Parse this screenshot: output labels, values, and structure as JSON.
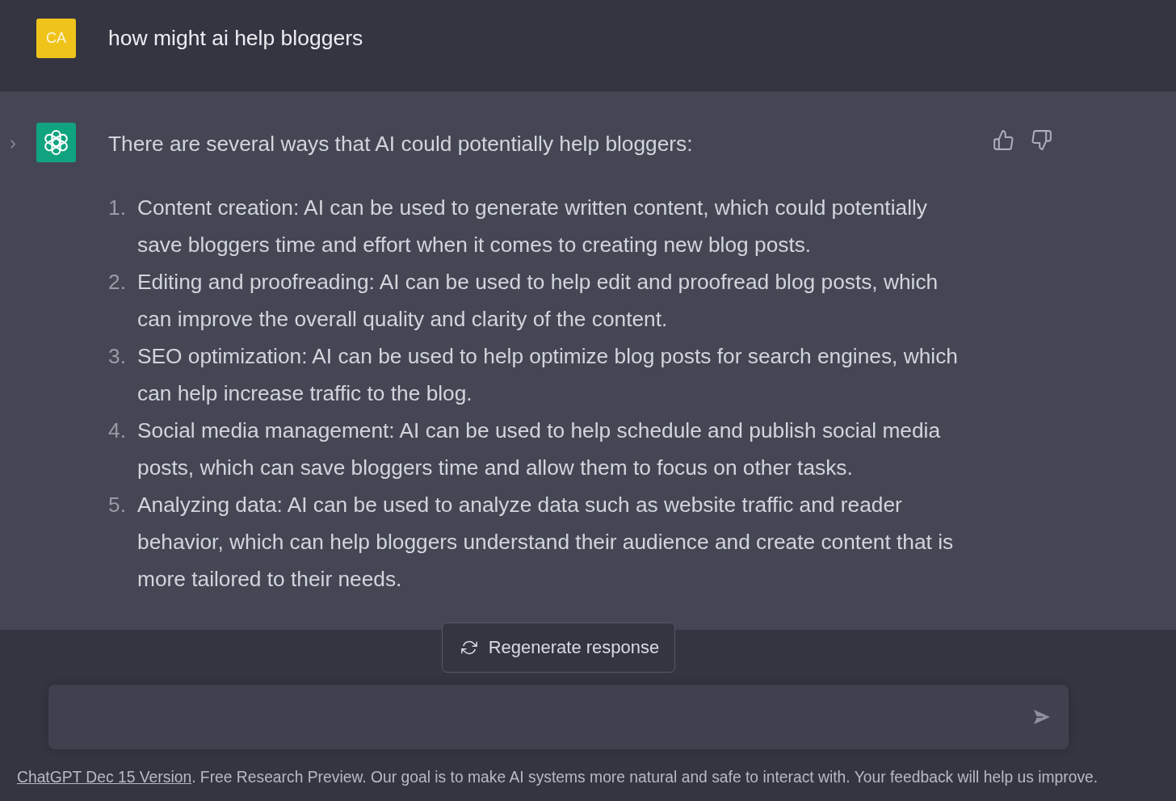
{
  "user_message": {
    "avatar_initials": "CA",
    "text": "how might ai help bloggers"
  },
  "assistant_message": {
    "intro": "There are several ways that AI could potentially help bloggers:",
    "items": [
      {
        "number": "1.",
        "text": "Content creation: AI can be used to generate written content, which could potentially save bloggers time and effort when it comes to creating new blog posts."
      },
      {
        "number": "2.",
        "text": "Editing and proofreading: AI can be used to help edit and proofread blog posts, which can improve the overall quality and clarity of the content."
      },
      {
        "number": "3.",
        "text": "SEO optimization: AI can be used to help optimize blog posts for search engines, which can help increase traffic to the blog."
      },
      {
        "number": "4.",
        "text": "Social media management: AI can be used to help schedule and publish social media posts, which can save bloggers time and allow them to focus on other tasks."
      },
      {
        "number": "5.",
        "text": "Analyzing data: AI can be used to analyze data such as website traffic and reader behavior, which can help bloggers understand their audience and create content that is more tailored to their needs."
      }
    ]
  },
  "regenerate_button": {
    "label": "Regenerate response"
  },
  "footer": {
    "link": "ChatGPT Dec 15 Version",
    "text": ". Free Research Preview. Our goal is to make AI systems more natural and safe to interact with. Your feedback will help us improve."
  }
}
